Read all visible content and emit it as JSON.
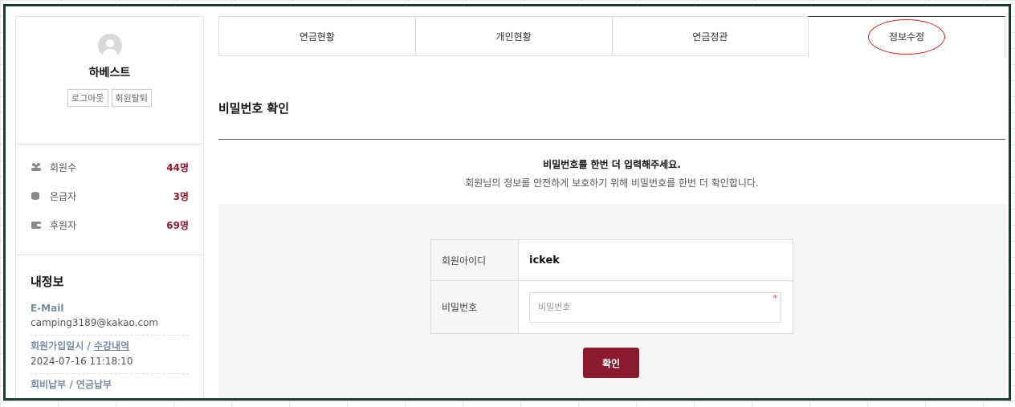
{
  "profile": {
    "name": "하베스트",
    "logout_label": "로그아웃",
    "withdraw_label": "회원탈퇴"
  },
  "stats": [
    {
      "icon": "members-icon",
      "label": "회원수",
      "value": "44명"
    },
    {
      "icon": "coins-icon",
      "label": "은급자",
      "value": "3명"
    },
    {
      "icon": "wallet-icon",
      "label": "후원자",
      "value": "69명"
    }
  ],
  "myinfo": {
    "title": "내정보",
    "email_label": "E-Mail",
    "email_value": "camping3189@kakao.com",
    "join_label": "회원가입일시 / ",
    "join_link": "수강내역",
    "join_value": "2024-07-16 11:18:10",
    "fee_label": "회비납부 / 연금납부"
  },
  "tabs": [
    {
      "label": "연금현황"
    },
    {
      "label": "개인현황"
    },
    {
      "label": "연금정관"
    },
    {
      "label": "정보수정",
      "active": true
    }
  ],
  "section": {
    "title": "비밀번호 확인",
    "notice_strong": "비밀번호를 한번 더 입력해주세요.",
    "notice_sub": "회원님의 정보를 안전하게 보호하기 위해 비밀번호를 한번 더 확인합니다."
  },
  "form": {
    "id_label": "회원아이디",
    "id_value": "ickek",
    "pw_label": "비밀번호",
    "pw_placeholder": "비밀번호",
    "required_mark": "*",
    "confirm_label": "확인"
  },
  "colors": {
    "accent": "#8b1a2e",
    "frame": "#1f3a34",
    "highlight_circle": "#d21f1f"
  }
}
